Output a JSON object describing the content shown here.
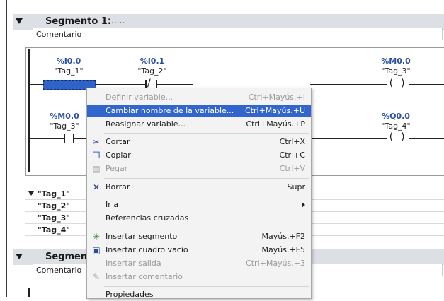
{
  "segments": [
    {
      "title": "Segmento 1:",
      "dots": ".....",
      "comment": "Comentario"
    },
    {
      "title": "Segmento",
      "comment": "Comentario"
    }
  ],
  "rungs": {
    "r1": {
      "c1": {
        "addr": "%I0.0",
        "tag": "\"Tag_1\""
      },
      "c2": {
        "addr": "%I0.1",
        "tag": "\"Tag_2\""
      },
      "coil": {
        "addr": "%M0.0",
        "tag": "\"Tag_3\"",
        "symbol": "( )"
      }
    },
    "r2": {
      "c1": {
        "addr": "%M0.0",
        "tag": "\"Tag_3\""
      },
      "coil": {
        "addr": "%Q0.0",
        "tag": "\"Tag_4\"",
        "symbol": "( )"
      }
    }
  },
  "tag_table": [
    "\"Tag_1\"",
    "\"Tag_2\"",
    "\"Tag_3\"",
    "\"Tag_4\""
  ],
  "context_menu": {
    "definir": {
      "label": "Definir variable...",
      "shortcut": "Ctrl+Mayús.+I"
    },
    "cambiar": {
      "label": "Cambiar nombre de la variable...",
      "shortcut": "Ctrl+Mayús.+U"
    },
    "reasignar": {
      "label": "Reasignar variable...",
      "shortcut": "Ctrl+Mayús.+P"
    },
    "cortar": {
      "label": "Cortar",
      "shortcut": "Ctrl+X"
    },
    "copiar": {
      "label": "Copiar",
      "shortcut": "Ctrl+C"
    },
    "pegar": {
      "label": "Pegar",
      "shortcut": "Ctrl+V"
    },
    "borrar": {
      "label": "Borrar",
      "shortcut": "Supr"
    },
    "ira": {
      "label": "Ir a"
    },
    "referencias": {
      "label": "Referencias cruzadas"
    },
    "ins_segmento": {
      "label": "Insertar segmento",
      "shortcut": "Mayús.+F2"
    },
    "ins_cuadro": {
      "label": "Insertar cuadro vacío",
      "shortcut": "Mayús.+F5"
    },
    "ins_salida": {
      "label": "Insertar salida",
      "shortcut": "Ctrl+Mayús.+3"
    },
    "ins_comentario": {
      "label": "Insertar comentario"
    },
    "propiedades": {
      "label": "Propiedades"
    }
  },
  "colors": {
    "highlight": "#3366cc",
    "address": "#2e4fa0"
  }
}
